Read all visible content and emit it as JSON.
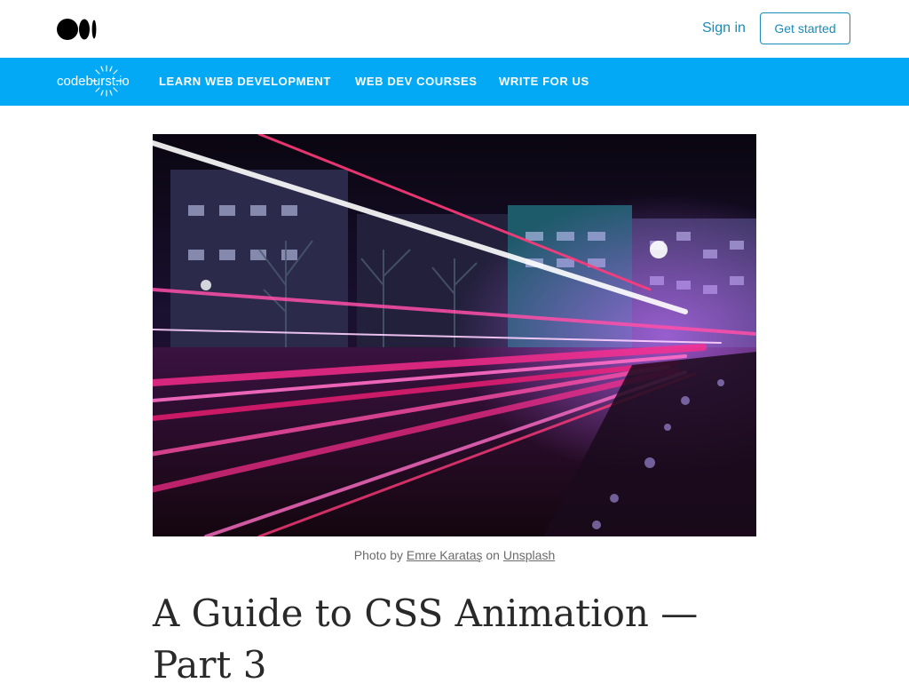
{
  "topbar": {
    "logo_icon": "medium-logo-icon",
    "sign_in": "Sign in",
    "get_started": "Get started",
    "accent": "#1a8bb8"
  },
  "navbar": {
    "background": "#03a9f4",
    "publication_logo": "codeburst.io",
    "links": [
      {
        "label": "LEARN WEB DEVELOPMENT"
      },
      {
        "label": "WEB DEV COURSES"
      },
      {
        "label": "WRITE FOR US"
      }
    ]
  },
  "article": {
    "hero_image": "night-street-light-trails-photo",
    "caption": {
      "prefix": "Photo by",
      "author": "Emre Karataş",
      "middle": "on",
      "source": "Unsplash"
    },
    "title": "A Guide to CSS Animation — Part 3"
  }
}
